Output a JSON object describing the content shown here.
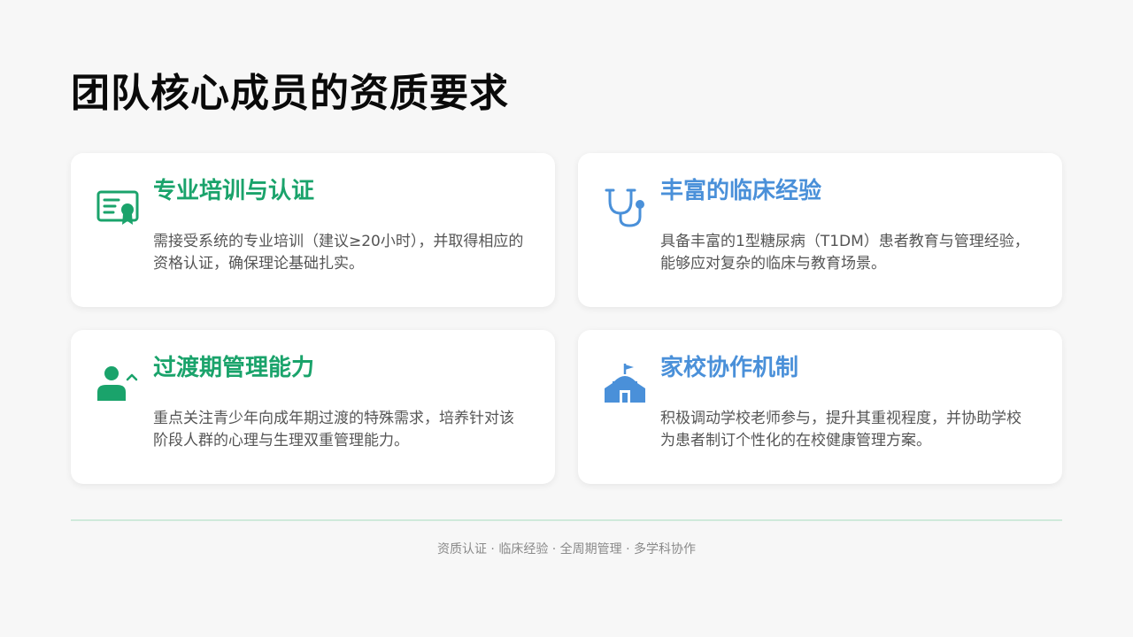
{
  "slide": {
    "title": "团队核心成员的资质要求",
    "accent_green": "#1aa36b",
    "accent_blue": "#4a90d9",
    "cards": [
      {
        "icon": "certificate-icon",
        "title": "专业培训与认证",
        "title_color": "#1aa36b",
        "description": "需接受系统的专业培训（建议≥20小时），并取得相应的资格认证，确保理论基础扎实。"
      },
      {
        "icon": "stethoscope-icon",
        "title": "丰富的临床经验",
        "title_color": "#4a90d9",
        "description": "具备丰富的1型糖尿病（T1DM）患者教育与管理经验，能够应对复杂的临床与教育场景。"
      },
      {
        "icon": "person-growth-icon",
        "title": "过渡期管理能力",
        "title_color": "#1aa36b",
        "description": "重点关注青少年向成年期过渡的特殊需求，培养针对该阶段人群的心理与生理双重管理能力。"
      },
      {
        "icon": "school-icon",
        "title": "家校协作机制",
        "title_color": "#4a90d9",
        "description": "积极调动学校老师参与，提升其重视程度，并协助学校为患者制订个性化的在校健康管理方案。"
      }
    ],
    "footer": "资质认证 · 临床经验 · 全周期管理 · 多学科协作"
  }
}
